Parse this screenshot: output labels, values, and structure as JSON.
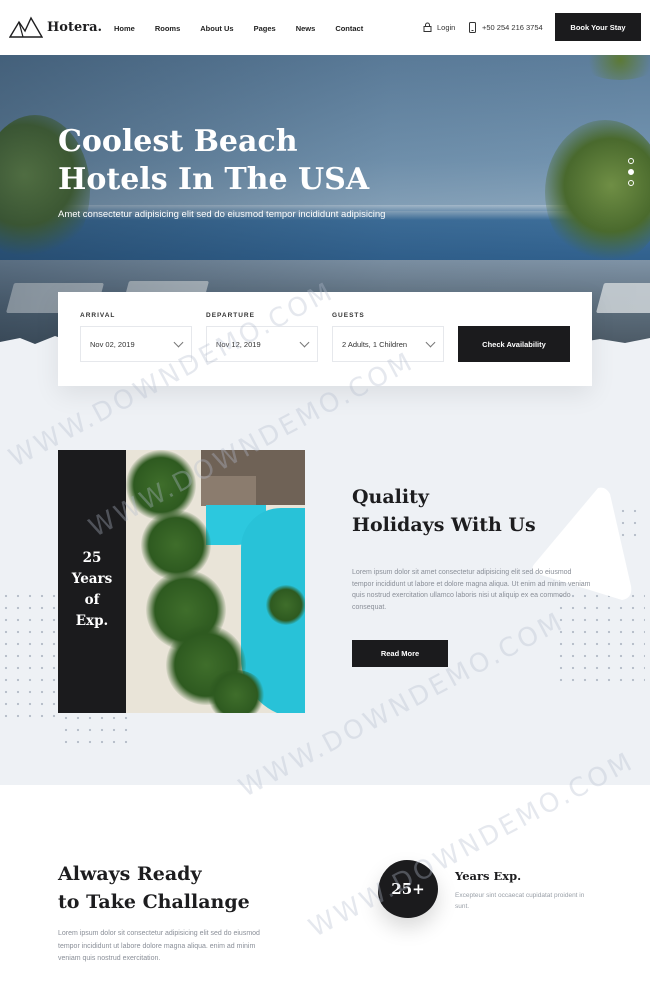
{
  "nav": {
    "logo_text": "Hotera.",
    "menu": [
      "Home",
      "Rooms",
      "About Us",
      "Pages",
      "News",
      "Contact"
    ],
    "login_label": "Login",
    "phone": "+50 254 216 3754",
    "cta": "Book Your Stay"
  },
  "hero": {
    "title": "Coolest Beach Hotels In The USA",
    "subtitle": "Amet consectetur adipisicing elit sed do eiusmod tempor incididunt adipisicing",
    "slider_dots": 3,
    "active_dot": 1
  },
  "booking": {
    "arrival_label": "ARRIVAL",
    "arrival_value": "Nov 02, 2019",
    "departure_label": "DEPARTURE",
    "departure_value": "Nov 12, 2019",
    "guests_label": "GUESTS",
    "guests_value": "2 Adults,  1 Children",
    "button": "Check Availability"
  },
  "about": {
    "years_line1": "25",
    "years_line2": "Years",
    "years_line3": "of",
    "years_line4": "Exp.",
    "title_line1": "Quality",
    "title_line2": "Holidays With Us",
    "text": "Lorem ipsum dolor sit amet consectetur adipisicing elit sed do eiusmod tempor incididunt ut labore et dolore magna aliqua. Ut enim ad minim veniam quis nostrud exercitation ullamco laboris nisi ut aliquip ex ea commodo consequat.",
    "button": "Read More"
  },
  "ready": {
    "title_line1": "Always Ready",
    "title_line2": "to Take Challange",
    "text": "Lorem ipsum dolor sit consectetur adipisicing elit sed do eiusmod tempor incididunt ut labore dolore magna aliqua. enim ad minim veniam quis nostrud exercitation.",
    "badge": "25+",
    "years_title": "Years Exp.",
    "years_text": "Excepteur sint occaecat cupidatat proident in sunt."
  },
  "watermark": "WWW.DOWNDEMO.COM",
  "colors": {
    "dark": "#1b1b1d",
    "light_bg": "#eef1f5",
    "body_text": "#8a8f98"
  }
}
